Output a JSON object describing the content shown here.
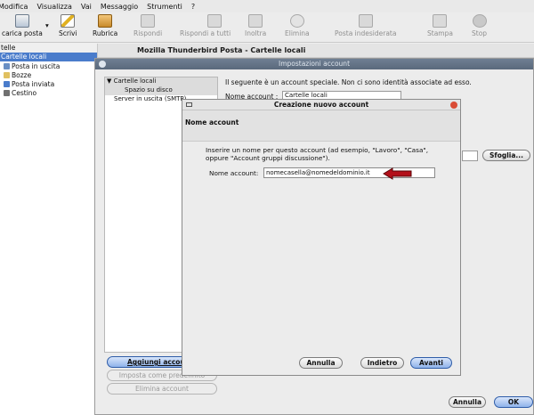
{
  "menu": [
    "Modifica",
    "Visualizza",
    "Vai",
    "Messaggio",
    "Strumenti",
    "?"
  ],
  "toolbar": {
    "get_mail": "carica posta",
    "write": "Scrivi",
    "address_book": "Rubrica",
    "reply": "Rispondi",
    "reply_all": "Rispondi a tutti",
    "forward": "Inoltra",
    "delete": "Elimina",
    "junk": "Posta indesiderata",
    "print": "Stampa",
    "stop": "Stop"
  },
  "sidebar": {
    "header": "telle",
    "selected": "Cartelle locali",
    "items": [
      "Posta in uscita",
      "Bozze",
      "Posta inviata",
      "Cestino"
    ]
  },
  "main_header": "Mozilla Thunderbird Posta - Cartelle locali",
  "account_window": {
    "title": "Impostazioni account",
    "tree": {
      "root": "▼ Cartelle locali",
      "child": "Spazio su disco",
      "smtp": "Server in uscita (SMTP)"
    },
    "info_text": "Il seguente è un account speciale. Non ci sono identità associate ad esso.",
    "name_label": "Nome account :",
    "name_value": "Cartelle locali",
    "browse_button": "Sfoglia...",
    "add_account_button": "Aggiungi account",
    "set_default_button": "Imposta come predefinito",
    "remove_account_button": "Elimina account",
    "cancel_button": "Annulla",
    "ok_button": "OK"
  },
  "dialog": {
    "title": "Creazione nuovo account",
    "header": "Nome account",
    "instructions_1": "Inserire un nome per questo account (ad esempio, \"Lavoro\", \"Casa\",",
    "instructions_2": "oppure \"Account gruppi discussione\").",
    "name_label": "Nome account:",
    "name_value": "nomecasella@nomedeldominio.it",
    "cancel_button": "Annulla",
    "back_button": "Indietro",
    "next_button": "Avanti"
  },
  "colors": {
    "selection": "#4a7ccb",
    "title_bar": "#5a697c",
    "arrow": "#b3101a",
    "primary_button": "#8fb3ea"
  }
}
